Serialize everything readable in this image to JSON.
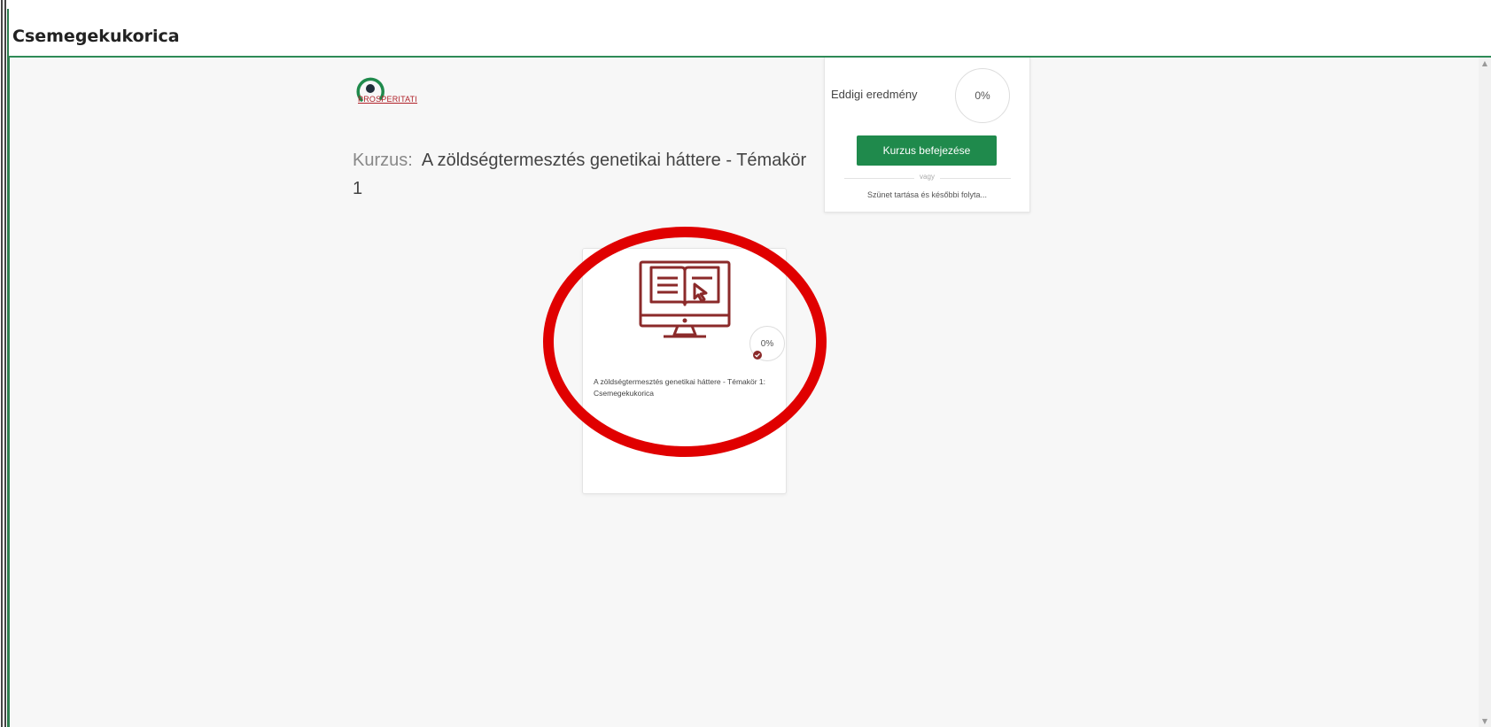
{
  "header": {
    "title": "Csemegekukorica"
  },
  "logo": {
    "text": "PROSPERITATI"
  },
  "course": {
    "label": "Kurzus:",
    "name": "A zöldségtermesztés genetikai háttere - Témakör 1"
  },
  "score_panel": {
    "label": "Eddigi eredmény",
    "value": "0%",
    "finish_button": "Kurzus befejezése",
    "or_text": "vagy",
    "pause_link": "Szünet tartása és későbbi folyta..."
  },
  "module": {
    "progress": "0%",
    "title": "A zöldségtermesztés genetikai háttere - Témakör 1: Csemegekukorica",
    "icon": "monitor-book-icon"
  },
  "colors": {
    "accent_green": "#1f8a4c",
    "icon_red": "#8b2a2a",
    "annotation_red": "#e00000",
    "logo_red": "#b0222a"
  }
}
